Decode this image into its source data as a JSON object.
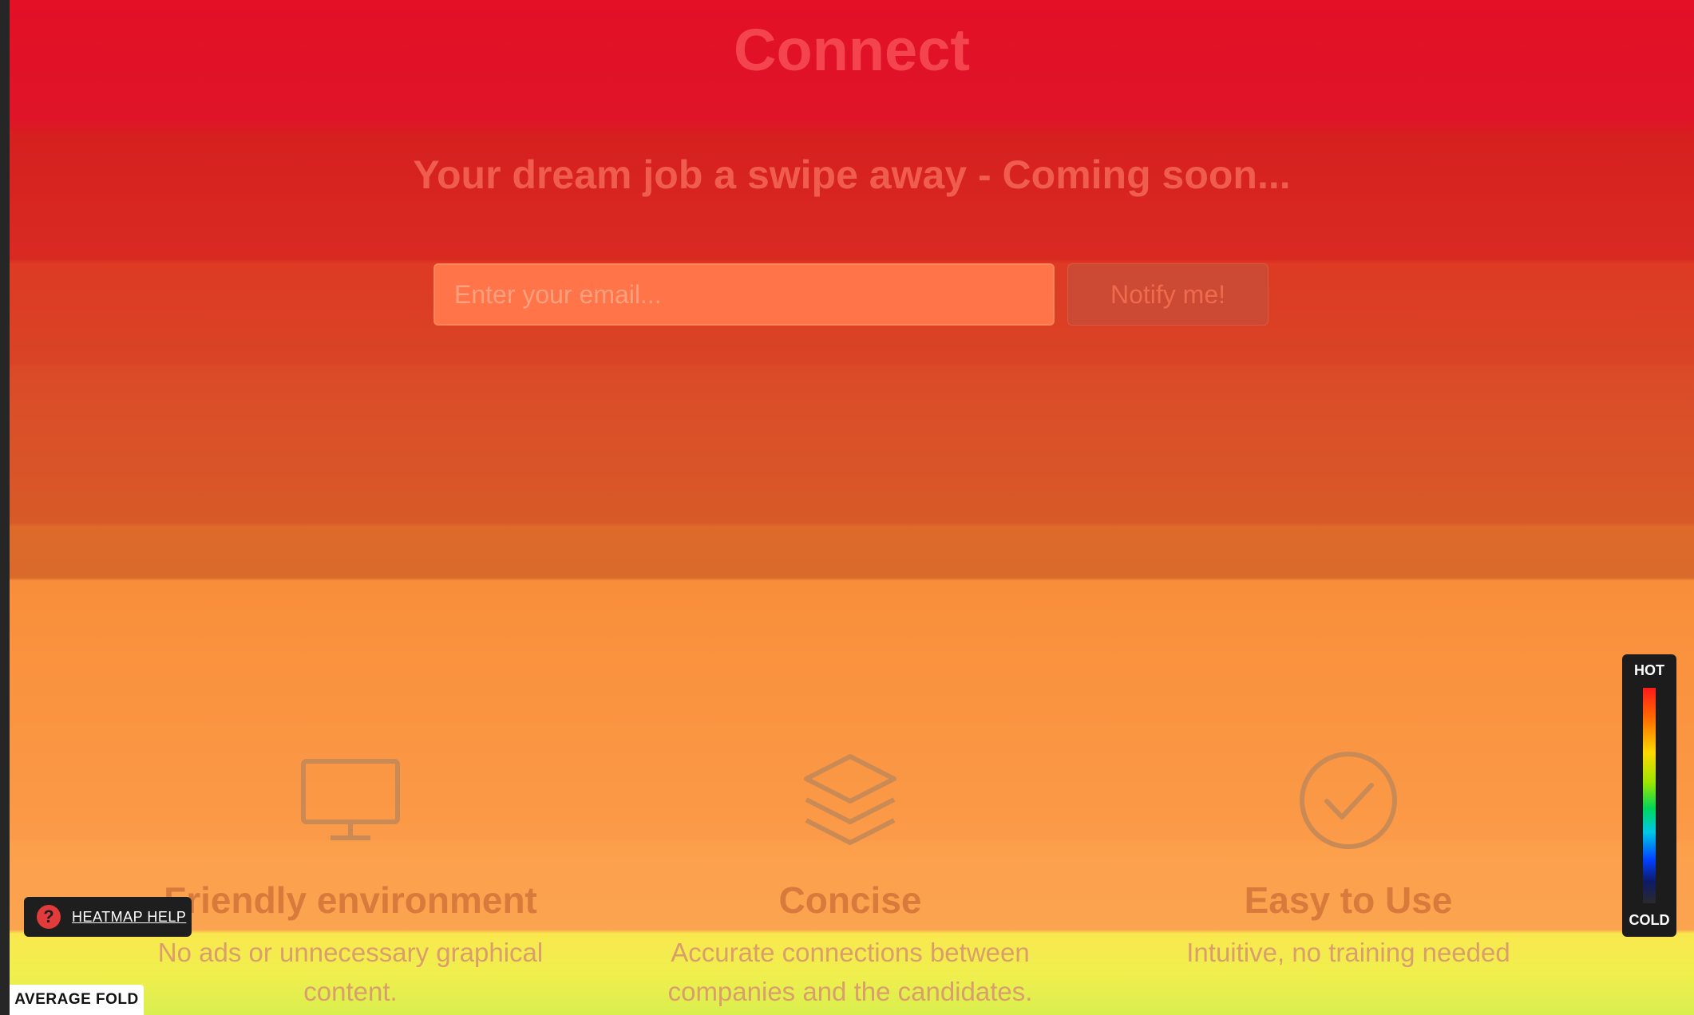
{
  "page": {
    "title": "Connect",
    "subtitle": "Your dream job a swipe away - Coming soon...",
    "email_placeholder": "Enter your email...",
    "notify_label": "Notify me!"
  },
  "features": [
    {
      "icon": "monitor-icon",
      "title": "Friendly environment",
      "text": "No ads or unnecessary graphical content."
    },
    {
      "icon": "layers-icon",
      "title": "Concise",
      "text": "Accurate connections between companies and the candidates."
    },
    {
      "icon": "check-circle-icon",
      "title": "Easy to Use",
      "text": "Intuitive, no training needed"
    }
  ],
  "heatmap": {
    "help_label": "HEATMAP HELP",
    "help_icon": "question-icon",
    "fold_label": "AVERAGE FOLD",
    "legend_hot": "HOT",
    "legend_cold": "COLD"
  },
  "colors": {
    "hot": "#e31026",
    "warm": "#fb9a48",
    "fold": "#f9e84e"
  }
}
